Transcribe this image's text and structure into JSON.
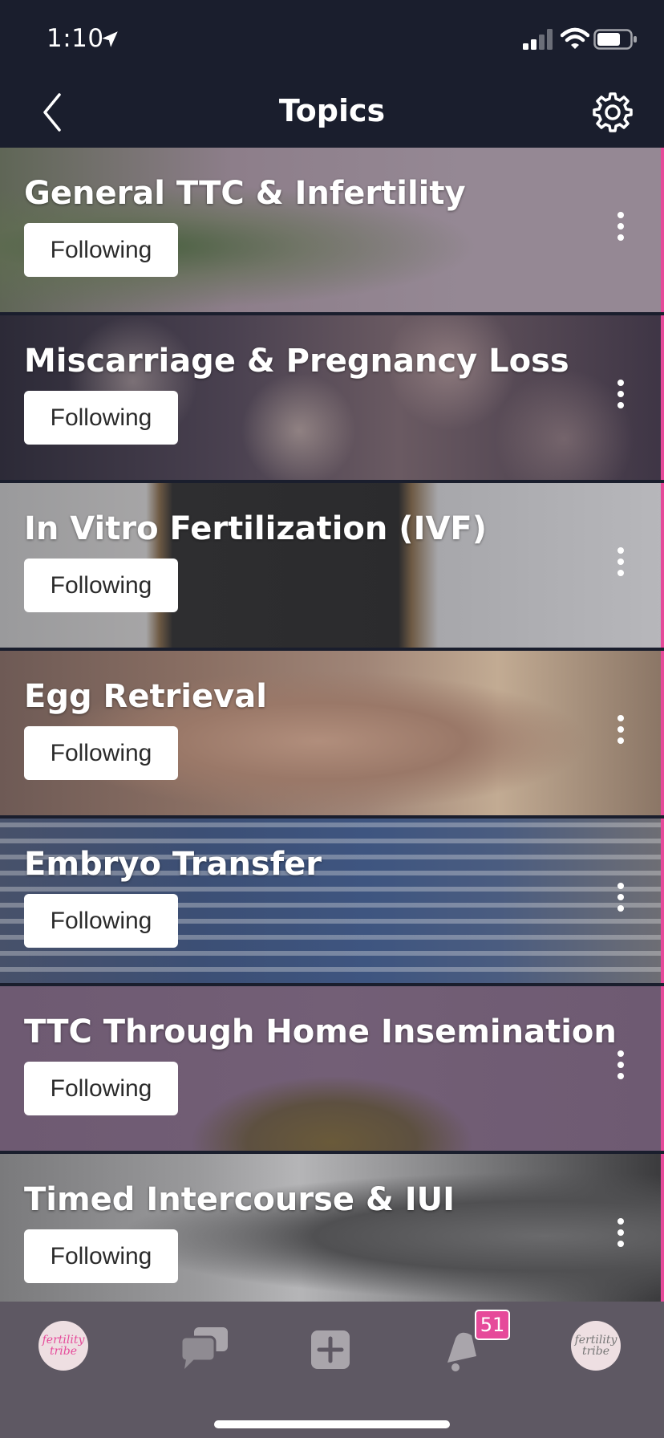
{
  "status_bar": {
    "time": "1:10",
    "icons": [
      "location-arrow-icon",
      "cellular-signal-icon",
      "wifi-icon",
      "battery-icon"
    ]
  },
  "nav": {
    "title": "Topics",
    "back_icon": "chevron-left-icon",
    "settings_icon": "gear-icon"
  },
  "topics": [
    {
      "title": "General TTC & Infertility",
      "button": "Following"
    },
    {
      "title": "Miscarriage & Pregnancy Loss",
      "button": "Following"
    },
    {
      "title": "In Vitro Fertilization (IVF)",
      "button": "Following"
    },
    {
      "title": "Egg Retrieval",
      "button": "Following"
    },
    {
      "title": "Embryo Transfer",
      "button": "Following"
    },
    {
      "title": "TTC Through Home Insemination",
      "button": "Following"
    },
    {
      "title": "Timed Intercourse & IUI",
      "button": "Following"
    }
  ],
  "tab_bar": {
    "tabs": [
      "fertility-tribe-logo",
      "chat-bubbles-icon",
      "add-post-icon",
      "bell-icon",
      "profile-avatar"
    ],
    "notification_count": "51",
    "logo_text": "fertility tribe"
  },
  "colors": {
    "background": "#1a1e2d",
    "accent": "#e64a9a",
    "tab_bar": "#5e5863"
  }
}
